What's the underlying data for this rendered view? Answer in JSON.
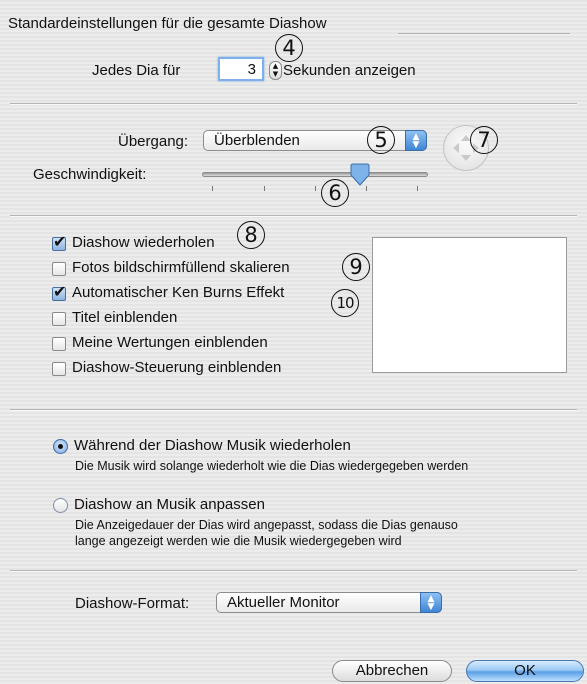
{
  "group_title": "Standardeinstellungen für die gesamte Diashow",
  "duration": {
    "label_before": "Jedes Dia für",
    "value": "3",
    "label_after": "Sekunden anzeigen"
  },
  "transition": {
    "label": "Übergang:",
    "selected": "Überblenden"
  },
  "speed": {
    "label": "Geschwindigkeit:",
    "level": 0.72
  },
  "options": [
    {
      "label": "Diashow wiederholen",
      "checked": true
    },
    {
      "label": "Fotos bildschirmfüllend skalieren",
      "checked": false
    },
    {
      "label": "Automatischer Ken Burns Effekt",
      "checked": true
    },
    {
      "label": "Titel einblenden",
      "checked": false
    },
    {
      "label": "Meine Wertungen einblenden",
      "checked": false
    },
    {
      "label": "Diashow-Steuerung einblenden",
      "checked": false
    }
  ],
  "music": {
    "repeat": {
      "label": "Während der Diashow Musik wiederholen",
      "description": "Die Musik wird solange wiederholt wie die Dias wiedergegeben werden",
      "selected": true
    },
    "fit": {
      "label": "Diashow an Musik anpassen",
      "description_line1": "Die Anzeigedauer der Dias wird angepasst, sodass die Dias genauso",
      "description_line2": "lange angezeigt werden wie die Musik wiedergegeben wird",
      "selected": false
    }
  },
  "format": {
    "label": "Diashow-Format:",
    "selected": "Aktueller Monitor"
  },
  "buttons": {
    "cancel": "Abbrechen",
    "ok": "OK"
  },
  "callouts": {
    "c4": "4",
    "c5": "5",
    "c6": "6",
    "c7": "7",
    "c8": "8",
    "c9": "9",
    "c10": "10"
  }
}
